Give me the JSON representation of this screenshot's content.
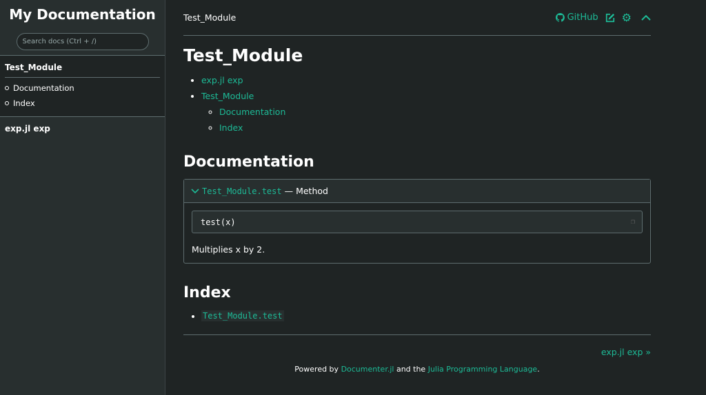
{
  "sidebar": {
    "title": "My Documentation",
    "search_placeholder": "Search docs (Ctrl + /)",
    "active": "Test_Module",
    "sub": [
      "Documentation",
      "Index"
    ],
    "other": "exp.jl exp"
  },
  "navbar": {
    "breadcrumb": "Test_Module",
    "github": "GitHub"
  },
  "main": {
    "title": "Test_Module",
    "toc": [
      "exp.jl exp",
      "Test_Module"
    ],
    "toc_sub": [
      "Documentation",
      "Index"
    ],
    "doc_heading": "Documentation",
    "binding": "Test_Module.test",
    "sep": "—",
    "category": "Method",
    "signature": "test(x)",
    "description": "Multiplies x by 2.",
    "index_heading": "Index",
    "index_items": [
      "Test_Module.test"
    ]
  },
  "footer": {
    "next": "exp.jl exp »",
    "powered": "Powered by",
    "documenter": "Documenter.jl",
    "and": "and the",
    "julia": "Julia Programming Language",
    "dot": "."
  },
  "colors": {
    "accent": "#1dbb97",
    "bg": "#1f2424",
    "sidebar": "#282f2f"
  }
}
